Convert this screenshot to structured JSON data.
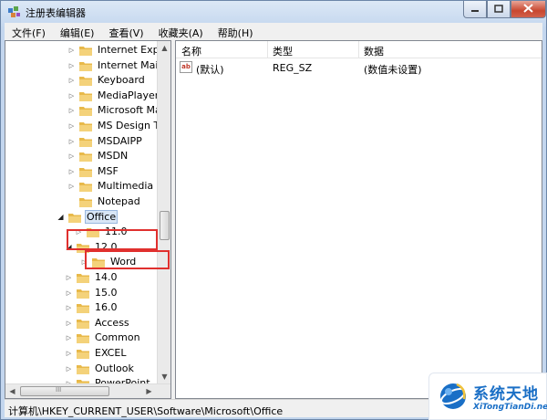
{
  "window": {
    "title": "注册表编辑器"
  },
  "menu": [
    "文件(F)",
    "编辑(E)",
    "查看(V)",
    "收藏夹(A)",
    "帮助(H)"
  ],
  "tree": {
    "items": [
      {
        "label": "Internet Explor",
        "expander": "▷"
      },
      {
        "label": "Internet Mail a",
        "expander": "▷"
      },
      {
        "label": "Keyboard",
        "expander": "▷"
      },
      {
        "label": "MediaPlayer",
        "expander": "▷"
      },
      {
        "label": "Microsoft Mar",
        "expander": "▷"
      },
      {
        "label": "MS Design Toc",
        "expander": "▷"
      },
      {
        "label": "MSDAIPP",
        "expander": "▷"
      },
      {
        "label": "MSDN",
        "expander": "▷"
      },
      {
        "label": "MSF",
        "expander": "▷"
      },
      {
        "label": "Multimedia",
        "expander": "▷"
      },
      {
        "label": "Notepad",
        "expander": ""
      },
      {
        "label": "Office",
        "expander": "◢"
      },
      {
        "label": "11.0",
        "expander": "▷"
      },
      {
        "label": "12.0",
        "expander": "◢"
      },
      {
        "label": "Word",
        "expander": "▷"
      },
      {
        "label": "14.0",
        "expander": "▷"
      },
      {
        "label": "15.0",
        "expander": "▷"
      },
      {
        "label": "16.0",
        "expander": "▷"
      },
      {
        "label": "Access",
        "expander": "▷"
      },
      {
        "label": "Common",
        "expander": "▷"
      },
      {
        "label": "EXCEL",
        "expander": "▷"
      },
      {
        "label": "Outlook",
        "expander": "▷"
      },
      {
        "label": "PowerPoint",
        "expander": "▷"
      }
    ],
    "scroll_marks": {
      "up": "▲",
      "down": "▼",
      "left": "◀",
      "right": "▶",
      "grip": "III"
    }
  },
  "list": {
    "columns": [
      "名称",
      "类型",
      "数据"
    ],
    "rows": [
      {
        "icon": "ab",
        "name": "(默认)",
        "type": "REG_SZ",
        "data": "(数值未设置)"
      }
    ]
  },
  "status": {
    "path": "计算机\\HKEY_CURRENT_USER\\Software\\Microsoft\\Office"
  },
  "watermark": {
    "cn": "系统天地",
    "en": "XiTongTianDi.net"
  },
  "colors": {
    "highlight_box": "#e0302e",
    "folder": "#e8b94a",
    "watermark_blue": "#1a6fc6"
  }
}
